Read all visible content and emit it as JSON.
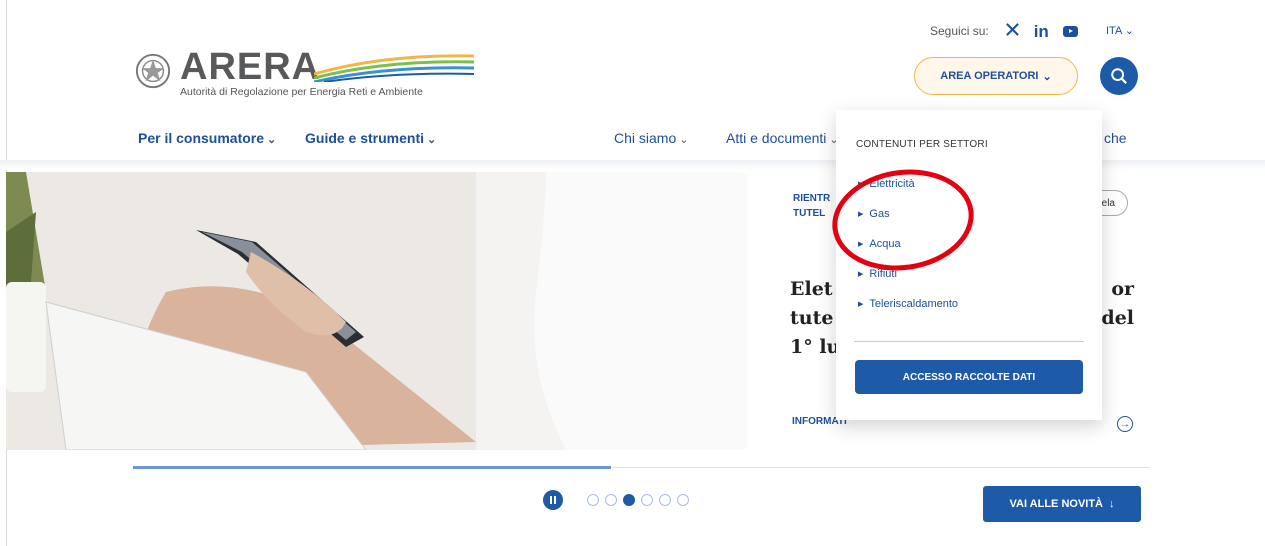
{
  "header": {
    "follow_label": "Seguici su:",
    "social": {
      "x_icon": "x-icon",
      "linkedin_icon": "linkedin-icon",
      "linkedin_text": "in",
      "youtube_icon": "youtube-icon"
    },
    "language": "ITA",
    "logo": {
      "wordmark": "ARERA",
      "subtitle": "Autorità di Regolazione per Energia Reti e Ambiente"
    },
    "area_operatori_label": "AREA OPERATORI",
    "search_icon": "search-icon"
  },
  "nav": {
    "left": [
      "Per il consumatore",
      "Guide e strumenti"
    ],
    "right": [
      "Chi siamo",
      "Atti e documenti"
    ],
    "partial": "che"
  },
  "hero": {
    "eyebrow_line1": "RIENTR",
    "eyebrow_line2": "TUTEL",
    "tag_pill": "ela",
    "headline_lines": [
      {
        "left": "Elet",
        "right": "or"
      },
      {
        "left": "tute",
        "right": "del"
      },
      {
        "left": "1° lu",
        "right": ""
      }
    ],
    "info_link": "INFORMATI"
  },
  "dropdown": {
    "title": "CONTENUTI PER SETTORI",
    "items": [
      "Elettricità",
      "Gas",
      "Acqua",
      "Rifiuti",
      "Teleriscaldamento"
    ],
    "button_label": "ACCESSO RACCOLTE DATI"
  },
  "carousel": {
    "progress": 0.47,
    "dot_count": 6,
    "active_dot_index": 2,
    "cta_label": "VAI ALLE NOVITÀ"
  },
  "colors": {
    "brand_blue": "#1d5aa8",
    "link_blue": "#1d4f9c",
    "accent_orange": "#f0b64a",
    "annotation_red": "#e3000f"
  }
}
